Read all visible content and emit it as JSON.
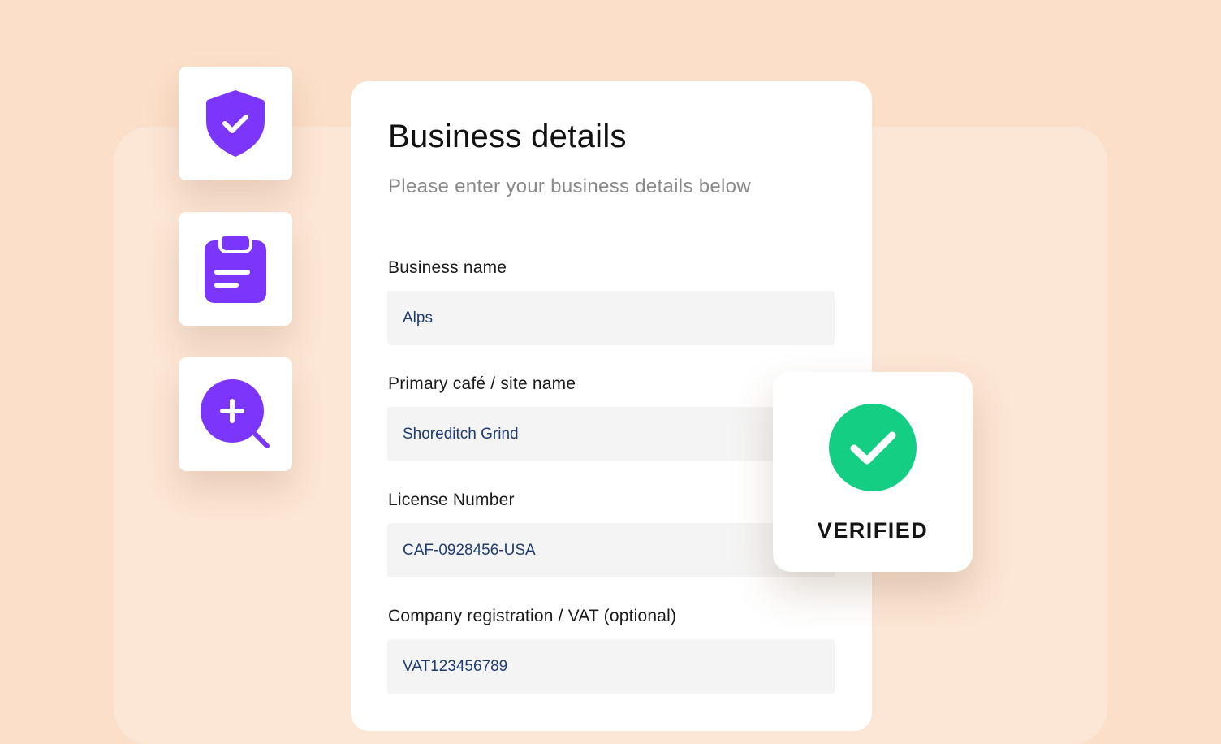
{
  "colors": {
    "background": "#FBDFC8",
    "panel": "#FCE6D5",
    "accent_purple": "#7B35FB",
    "success_green": "#14CE84",
    "input_bg": "#F4F4F4",
    "input_text": "#1F3D73"
  },
  "side_icons": [
    {
      "icon": "shield-check-icon"
    },
    {
      "icon": "clipboard-icon"
    },
    {
      "icon": "search-plus-icon"
    }
  ],
  "form": {
    "title": "Business details",
    "subtitle": "Please enter your business details below",
    "fields": [
      {
        "label": "Business name",
        "value": "Alps"
      },
      {
        "label": "Primary café / site name",
        "value": "Shoreditch Grind"
      },
      {
        "label": "License Number",
        "value": "CAF-0928456-USA"
      },
      {
        "label": "Company registration / VAT (optional)",
        "value": "VAT123456789"
      }
    ]
  },
  "verified": {
    "icon": "check-circle-icon",
    "label": "VERIFIED"
  }
}
